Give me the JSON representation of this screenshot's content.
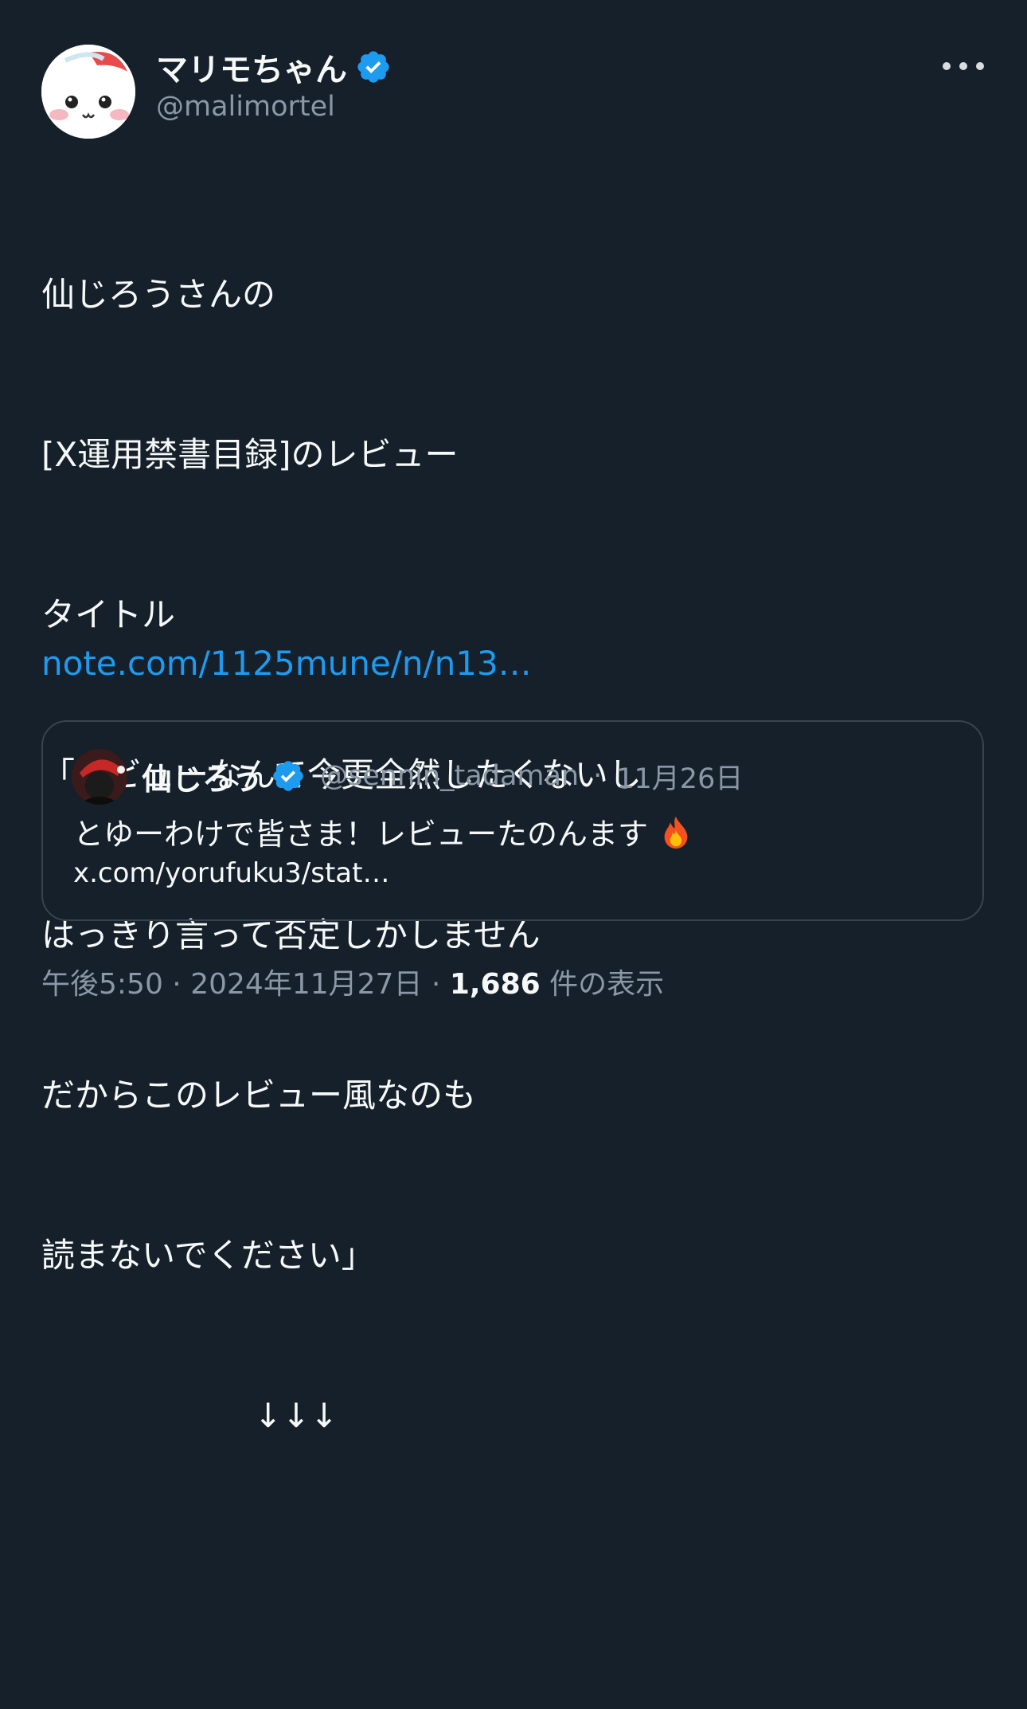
{
  "colors": {
    "background": "#15202b",
    "text": "#f7f9f9",
    "secondary_text": "#8b98a5",
    "link": "#1d9bf0",
    "verified": "#1d9bf0",
    "border": "#38444d"
  },
  "author": {
    "display_name": "マリモちゃん",
    "handle": "@malimortel",
    "verified_icon": "verified-badge-icon",
    "avatar_icon": "avatar-cartoon-face"
  },
  "more_icon": "more-options-icon",
  "body_lines": [
    "仙じろうさんの",
    "[X運用禁書目録]のレビュー",
    "タイトル",
    "「レビューなんて今更全然したくないし",
    "はっきり言って否定しかしません",
    "だからこのレビュー風なのも",
    "読まないでください」",
    "                    ↓↓↓",
    ""
  ],
  "link_text": "note.com/1125mune/n/n13…",
  "quote": {
    "display_name": "仙じろう",
    "handle": "@sennin_tadaman",
    "separator": "·",
    "date": "11月26日",
    "text": "とゆーわけで皆さま！レビューたのんます",
    "emoji_icon": "fire-icon",
    "link_text": "x.com/yorufuku3/stat…"
  },
  "footer": {
    "time": "午後5:50",
    "separator": "·",
    "date": "2024年11月27日",
    "views_count": "1,686",
    "views_label": "件の表示"
  }
}
